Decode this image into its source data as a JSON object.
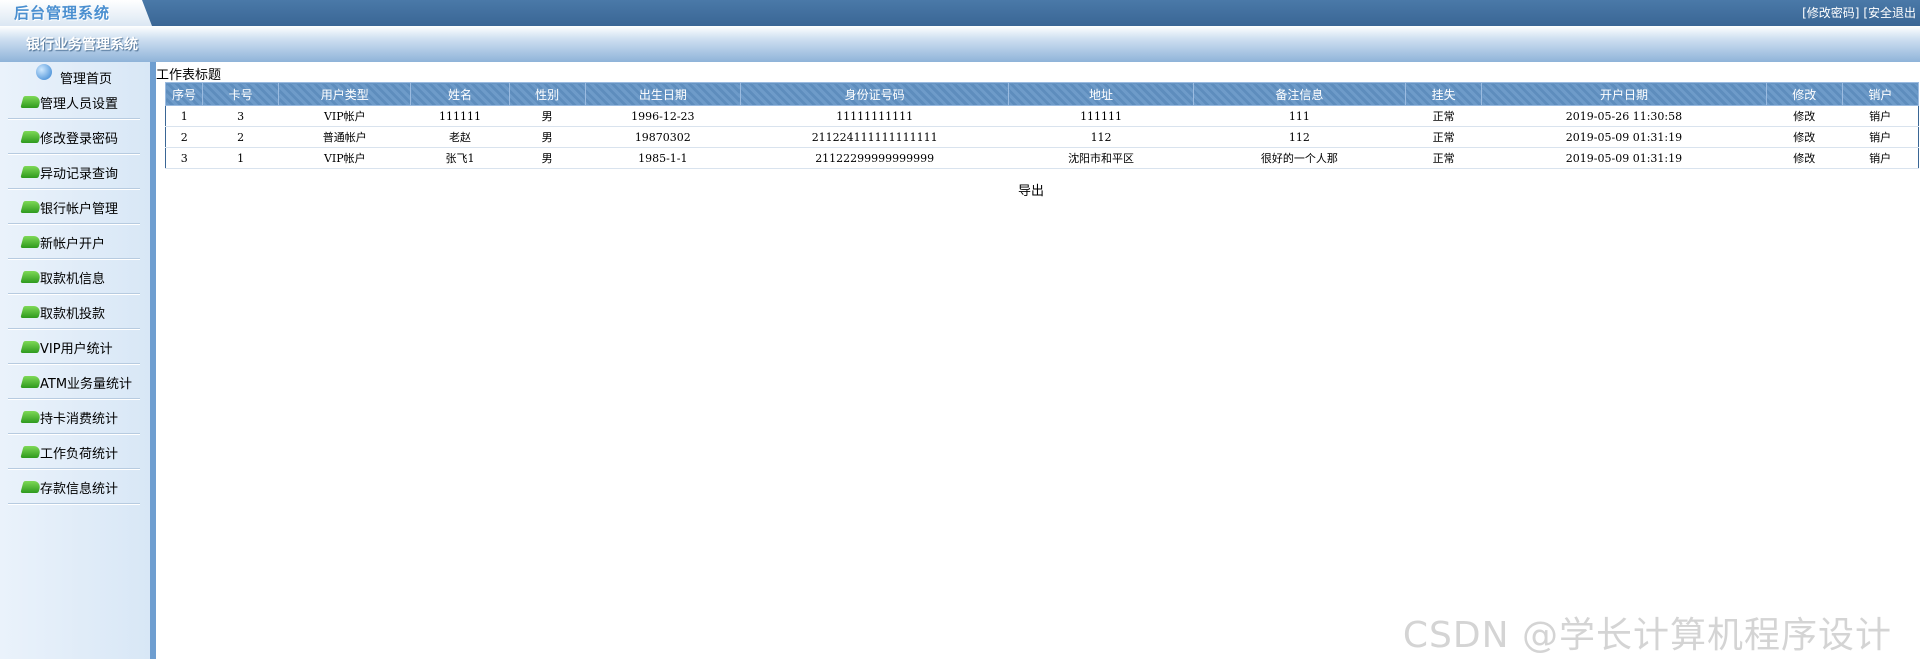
{
  "header": {
    "logo_text": "后台管理系统",
    "change_password": "[修改密码]",
    "logout": "[安全退出"
  },
  "system_title": "银行业务管理系统",
  "sidebar": {
    "home_label": "管理首页",
    "items": [
      {
        "label": "管理人员设置"
      },
      {
        "label": "修改登录密码"
      },
      {
        "label": "异动记录查询"
      },
      {
        "label": "银行帐户管理"
      },
      {
        "label": "新帐户开户"
      },
      {
        "label": "取款机信息"
      },
      {
        "label": "取款机投款"
      },
      {
        "label": "VIP用户统计"
      },
      {
        "label": "ATM业务量统计"
      },
      {
        "label": "持卡消费统计"
      },
      {
        "label": "工作负荷统计"
      },
      {
        "label": "存款信息统计"
      }
    ]
  },
  "main": {
    "title": "工作表标题",
    "columns": [
      "序号",
      "卡号",
      "用户类型",
      "姓名",
      "性别",
      "出生日期",
      "身份证号码",
      "地址",
      "备注信息",
      "挂失",
      "开户日期",
      "修改",
      "销户"
    ],
    "rows": [
      [
        "1",
        "3",
        "VIP帐户",
        "111111",
        "男",
        "1996-12-23",
        "11111111111",
        "111111",
        "111",
        "正常",
        "2019-05-26 11:30:58",
        "修改",
        "销户"
      ],
      [
        "2",
        "2",
        "普通帐户",
        "老赵",
        "男",
        "19870302",
        "211224111111111111",
        "112",
        "112",
        "正常",
        "2019-05-09 01:31:19",
        "修改",
        "销户"
      ],
      [
        "3",
        "1",
        "VIP帐户",
        "张飞1",
        "男",
        "1985-1-1",
        "21122299999999999",
        "沈阳市和平区",
        "很好的一个人那",
        "正常",
        "2019-05-09 01:31:19",
        "修改",
        "销户"
      ]
    ],
    "export_label": "导出"
  },
  "watermark": "CSDN @学长计算机程序设计"
}
